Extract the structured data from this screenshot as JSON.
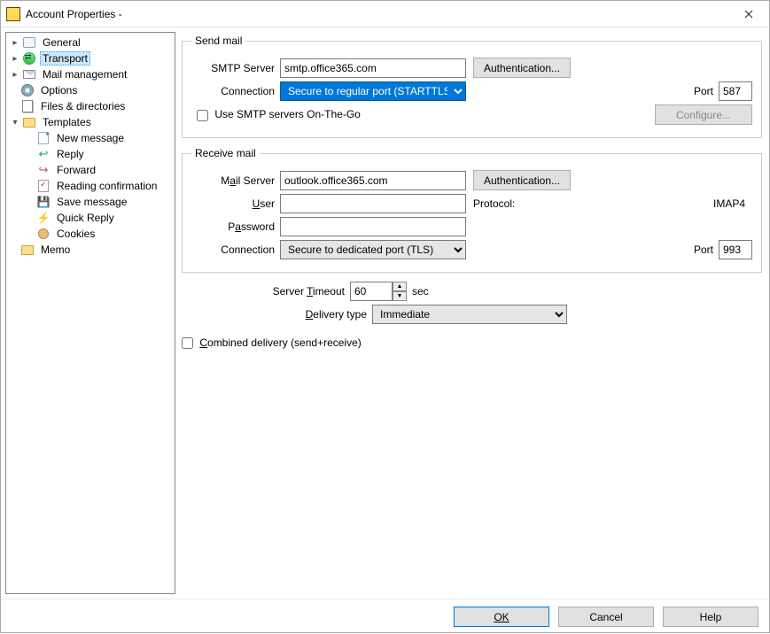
{
  "window": {
    "title": "Account Properties -"
  },
  "tree": {
    "items": [
      {
        "label": "General",
        "icon": "general"
      },
      {
        "label": "Transport",
        "icon": "transport",
        "selected": true
      },
      {
        "label": "Mail management",
        "icon": "mailmgmt"
      },
      {
        "label": "Options",
        "icon": "options"
      },
      {
        "label": "Files & directories",
        "icon": "files"
      },
      {
        "label": "Templates",
        "icon": "folder",
        "expanded": true,
        "children": [
          {
            "label": "New message",
            "icon": "newmsg"
          },
          {
            "label": "Reply",
            "icon": "reply"
          },
          {
            "label": "Forward",
            "icon": "forward"
          },
          {
            "label": "Reading confirmation",
            "icon": "reading"
          },
          {
            "label": "Save message",
            "icon": "save"
          },
          {
            "label": "Quick Reply",
            "icon": "quick"
          },
          {
            "label": "Cookies",
            "icon": "cookies"
          }
        ]
      },
      {
        "label": "Memo",
        "icon": "memo"
      }
    ]
  },
  "send": {
    "legend": "Send mail",
    "smtp_label": "SMTP Server",
    "smtp_value": "smtp.office365.com",
    "auth_button": "Authentication...",
    "conn_label": "Connection",
    "conn_value": "Secure to regular port (STARTTLS)",
    "port_label": "Port",
    "port_value": "587",
    "onthego_label": "Use SMTP servers On-The-Go",
    "configure_button": "Configure..."
  },
  "recv": {
    "legend": "Receive mail",
    "mail_label_pre": "M",
    "mail_label_u": "a",
    "mail_label_post": "il Server",
    "mail_value": "outlook.office365.com",
    "auth_button": "Authentication...",
    "user_label_u": "U",
    "user_label_post": "ser",
    "user_value": "",
    "protocol_label": "Protocol:",
    "protocol_value": "IMAP4",
    "pass_label_pre": "P",
    "pass_label_u": "a",
    "pass_label_post": "ssword",
    "pass_value": "",
    "conn_label": "Connection",
    "conn_value": "Secure to dedicated port (TLS)",
    "port_label": "Port",
    "port_value": "993"
  },
  "misc": {
    "timeout_label_pre": "Server ",
    "timeout_label_u": "T",
    "timeout_label_post": "imeout",
    "timeout_value": "60",
    "timeout_unit": "sec",
    "delivery_label_u": "D",
    "delivery_label_post": "elivery type",
    "delivery_value": "Immediate",
    "combined_label_u": "C",
    "combined_label_post": "ombined delivery (send+receive)"
  },
  "footer": {
    "ok": "OK",
    "cancel": "Cancel",
    "help": "Help"
  }
}
